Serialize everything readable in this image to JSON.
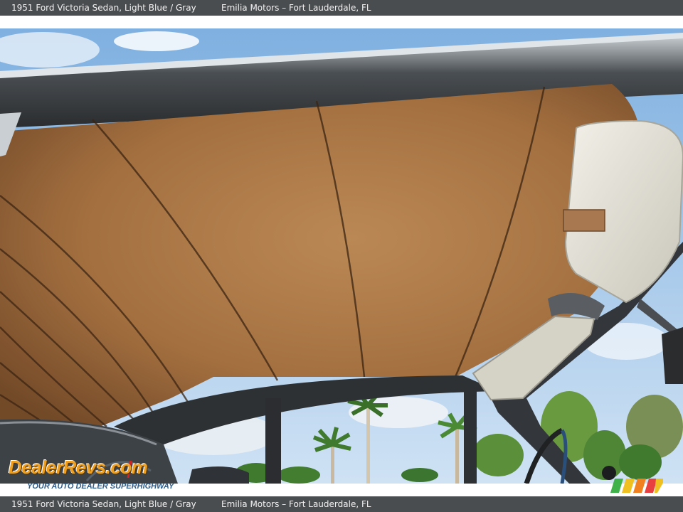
{
  "caption": {
    "title": "1951 Ford Victoria Sedan,",
    "colors": "Light Blue / Gray",
    "dealer": "Emilia Motors – Fort Lauderdale, FL"
  },
  "watermark": {
    "logo_text": "DealerRevs.com",
    "tagline": "YOUR AUTO DEALER SUPERHIGHWAY",
    "speedometer_digits": "a 5 6"
  },
  "photo": {
    "subject": "interior-headliner",
    "colors": {
      "headliner": "#b07a45",
      "headliner_dark": "#6e4320",
      "sky": "#9cc3ea",
      "trim": "#3a3d40",
      "visor": "#e4e2d8"
    }
  }
}
